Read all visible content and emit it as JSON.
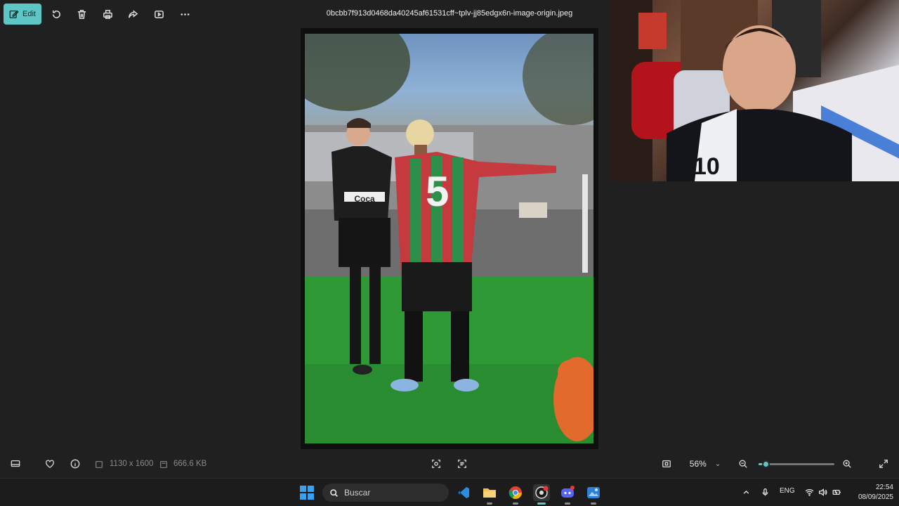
{
  "toolbar": {
    "edit_label": "Edit",
    "filename": "0bcbb7f913d0468da40245af61531cff~tplv-jj85edgx6n-image-origin.jpeg"
  },
  "photo": {
    "jersey_number": "5",
    "sponsor_text": "Coca"
  },
  "webcam": {
    "shirt_number": "10"
  },
  "status": {
    "dimensions": "1130 x 1600",
    "file_size": "666.6 KB",
    "zoom": "56%",
    "zoom_level": 0.1
  },
  "taskbar": {
    "search_placeholder": "Buscar",
    "language": "ENG",
    "time": "22:54",
    "date": "08/09/2025"
  },
  "colors": {
    "accent": "#5fc6c6",
    "background": "#202020",
    "taskbar": "#1c1c1c"
  }
}
